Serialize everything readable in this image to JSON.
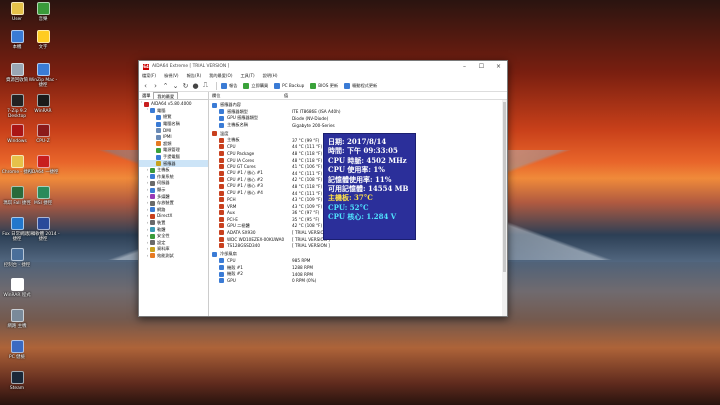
{
  "desktop_icons": [
    {
      "label": "User",
      "color": "#e6c14a"
    },
    {
      "label": "本機",
      "color": "#3a7bd5"
    },
    {
      "label": "資源回收筒",
      "color": "#9aa7b4"
    },
    {
      "label": "7-Zip 9.2 Desktop",
      "color": "#222"
    },
    {
      "label": "Windows",
      "color": "#aa1515"
    },
    {
      "label": "Chrome - 捷徑",
      "color": "#e6c14a"
    },
    {
      "label": "瑪琪 Fall 捷徑",
      "color": "#2a6a3a"
    },
    {
      "label": "Fox 日常網路 - 捷徑",
      "color": "#2277cc"
    },
    {
      "label": "控制台 - 捷徑",
      "color": "#4a6f9a"
    },
    {
      "label": "WinRAR 程式",
      "color": "#fff"
    },
    {
      "label": "網路 主機",
      "color": "#7a8a9a"
    },
    {
      "label": "PC 健檢",
      "color": "#3a6ac2"
    },
    {
      "label": "Steam",
      "color": "#1b2838"
    },
    {
      "label": "音樂",
      "color": "#3a9a3a"
    },
    {
      "label": "文字",
      "color": "#ffcc22"
    },
    {
      "label": "WinZip Mac - 捷徑",
      "color": "#3a7bd5"
    },
    {
      "label": "WinRAR",
      "color": "#1a1a1a"
    },
    {
      "label": "CPU-Z",
      "color": "#8a1a1a"
    },
    {
      "label": "AIDA64 一捷徑",
      "color": "#c81e1e"
    },
    {
      "label": "MSI 捷徑",
      "color": "#2a8a5a"
    },
    {
      "label": "剪輯軟體 2014 - 捷徑",
      "color": "#2a4a9a"
    }
  ],
  "window": {
    "title": "AIDA64 Extreme  [ TRIAL VERSION ]",
    "app_icon": "64",
    "menu": [
      "檔案(F)",
      "檢視(V)",
      "報告(R)",
      "我的最愛(O)",
      "工具(T)",
      "說明(H)"
    ],
    "toolbar": [
      "報告",
      "立即購買",
      "PC Backup",
      "BIOS 更新",
      "驅動程式更新"
    ],
    "left_tabs": [
      "選單",
      "我的最愛"
    ],
    "tree": [
      {
        "label": "AIDA64 v5.80.4000",
        "level": 0,
        "color": "#c81e1e"
      },
      {
        "label": "電腦",
        "level": 1,
        "color": "#3a7bd5"
      },
      {
        "label": "總覽",
        "level": 2,
        "color": "#3a7bd5"
      },
      {
        "label": "電腦名稱",
        "level": 2,
        "color": "#3a7bd5"
      },
      {
        "label": "DMI",
        "level": 2,
        "color": "#6a8ab5"
      },
      {
        "label": "IPMI",
        "level": 2,
        "color": "#6a8ab5"
      },
      {
        "label": "超頻",
        "level": 2,
        "color": "#e67a22"
      },
      {
        "label": "電源管理",
        "level": 2,
        "color": "#3aa23a"
      },
      {
        "label": "手提電腦",
        "level": 2,
        "color": "#3a7bd5"
      },
      {
        "label": "感應器",
        "level": 2,
        "color": "#c8a21e",
        "selected": true
      },
      {
        "label": "主機板",
        "level": 1,
        "color": "#3a9a3a"
      },
      {
        "label": "作業系統",
        "level": 1,
        "color": "#3a7bd5"
      },
      {
        "label": "伺服器",
        "level": 1,
        "color": "#6a6a6a"
      },
      {
        "label": "顯示",
        "level": 1,
        "color": "#3a7bd5"
      },
      {
        "label": "多媒體",
        "level": 1,
        "color": "#9a3ab5"
      },
      {
        "label": "存放裝置",
        "level": 1,
        "color": "#6a6a6a"
      },
      {
        "label": "網路",
        "level": 1,
        "color": "#3a7bd5"
      },
      {
        "label": "DirectX",
        "level": 1,
        "color": "#c8401e"
      },
      {
        "label": "裝置",
        "level": 1,
        "color": "#6a6a6a"
      },
      {
        "label": "軟體",
        "level": 1,
        "color": "#3a9ab5"
      },
      {
        "label": "安全性",
        "level": 1,
        "color": "#3a9a3a"
      },
      {
        "label": "設定",
        "level": 1,
        "color": "#6a6a6a"
      },
      {
        "label": "資料庫",
        "level": 1,
        "color": "#c8a21e"
      },
      {
        "label": "效能測試",
        "level": 1,
        "color": "#e67a22"
      }
    ],
    "columns": [
      "欄位",
      "值"
    ],
    "groups": [
      {
        "title": "感應器內容",
        "color": "#3a7bd5",
        "rows": [
          {
            "field": "感應器類型",
            "value": "ITE IT8686E  (ISA A40h)"
          },
          {
            "field": "GPU 感應器類型",
            "value": "Diode  (NV-Diode)"
          },
          {
            "field": "主機板名稱",
            "value": "Gigabyte 200-Series"
          }
        ]
      },
      {
        "title": "溫度",
        "color": "#c8401e",
        "rows": [
          {
            "field": "主機板",
            "value": "37 °C  (99 °F)"
          },
          {
            "field": "CPU",
            "value": "44 °C  (111 °F)"
          },
          {
            "field": "CPU Package",
            "value": "48 °C  (118 °F)"
          },
          {
            "field": "CPU IA Cores",
            "value": "48 °C  (118 °F)"
          },
          {
            "field": "CPU GT Cores",
            "value": "41 °C  (106 °F)"
          },
          {
            "field": "CPU #1 / 核心 #1",
            "value": "44 °C  (111 °F)"
          },
          {
            "field": "CPU #1 / 核心 #2",
            "value": "42 °C  (108 °F)"
          },
          {
            "field": "CPU #1 / 核心 #3",
            "value": "48 °C  (118 °F)"
          },
          {
            "field": "CPU #1 / 核心 #4",
            "value": "44 °C  (111 °F)"
          },
          {
            "field": "PCH",
            "value": "43 °C  (109 °F)"
          },
          {
            "field": "VRM",
            "value": "43 °C  (109 °F)"
          },
          {
            "field": "Aux",
            "value": "36 °C  (97 °F)"
          },
          {
            "field": "PCI-E",
            "value": "35 °C  (95 °F)"
          },
          {
            "field": "GPU 二極體",
            "value": "42 °C  (108 °F)"
          },
          {
            "field": "ADATA SX930",
            "value": "[ TRIAL VERSION ]"
          },
          {
            "field": "WDC WD10EZEX-00KUWA0",
            "value": "[ TRIAL VERSION ]"
          },
          {
            "field": "TS128GSSD340",
            "value": "[ TRIAL VERSION ]"
          }
        ]
      },
      {
        "title": "冷卻風扇",
        "color": "#3a7bd5",
        "rows": [
          {
            "field": "CPU",
            "value": "985 RPM"
          },
          {
            "field": "機殼 #1",
            "value": "1288 RPM"
          },
          {
            "field": "機殼 #2",
            "value": "1408 RPM"
          },
          {
            "field": "GPU",
            "value": "0 RPM  (0%)"
          }
        ]
      }
    ]
  },
  "osd": {
    "lines": [
      {
        "text": "日期: 2017/8/14",
        "color": "white"
      },
      {
        "text": "時間: 下午 09:33:05",
        "color": "white"
      },
      {
        "text": "CPU 時脈: 4502 MHz",
        "color": "white"
      },
      {
        "text": "CPU 使用率: 1%",
        "color": "white"
      },
      {
        "text": "記憶體使用率: 11%",
        "color": "white"
      },
      {
        "text": "可用記憶體: 14554 MB",
        "color": "white"
      },
      {
        "text": "主機板: 37°C",
        "color": "yellow"
      },
      {
        "text": "CPU: 52°C",
        "color": "cyan"
      },
      {
        "text": "CPU 核心: 1.284 V",
        "color": "cyan"
      }
    ]
  }
}
